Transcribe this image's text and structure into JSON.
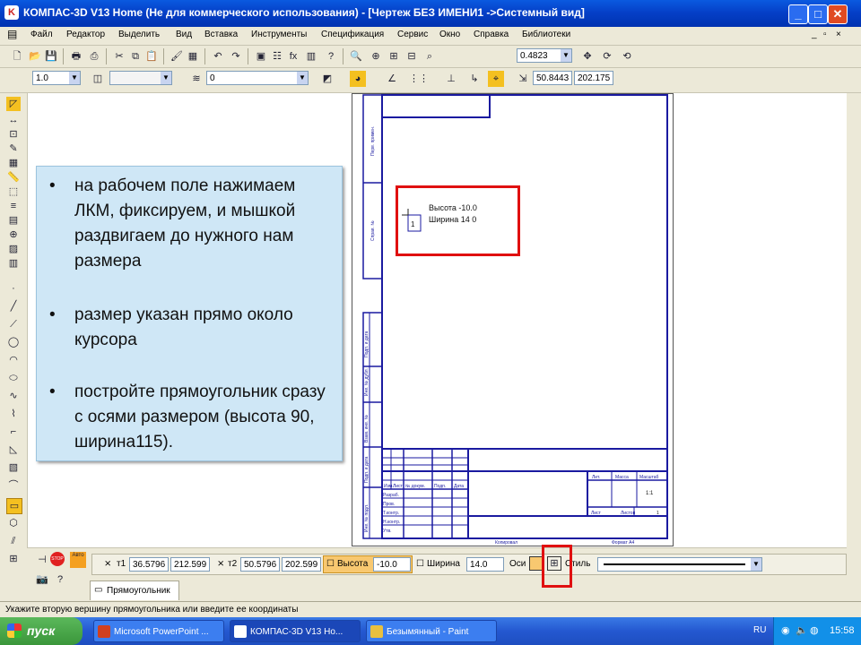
{
  "window": {
    "title": "КОМПАС-3D V13 Home (Не для коммерческого использования) - [Чертеж БЕЗ ИМЕНИ1 ->Системный вид]",
    "minimize": "_",
    "maximize": "□",
    "close": "✕"
  },
  "menu": {
    "items": [
      "Файл",
      "Редактор",
      "Выделить",
      "Вид",
      "Вставка",
      "Инструменты",
      "Спецификация",
      "Сервис",
      "Окно",
      "Справка",
      "Библиотеки"
    ]
  },
  "toolbar1": {
    "zoom_value": "0.4823"
  },
  "toolbar2": {
    "line_scale": "1.0",
    "layer": "0",
    "coord_x": "50.8443",
    "coord_y": "202.175"
  },
  "callout": {
    "bullet": "•",
    "items": [
      "на рабочем поле нажимаем ЛКМ, фиксируем, и мышкой раздвигаем до нужного нам размера",
      "размер указан прямо около курсора",
      "постройте прямоугольник сразу с осями размером (высота 90, ширина115)."
    ]
  },
  "cursor_hint": {
    "height_text": "Высота -10.0",
    "width_text": "Ширина 14 0",
    "marker": "1"
  },
  "drawing": {
    "title_block_bottom_left": "Копировал",
    "title_block_bottom_right": "Формат А4",
    "sheet_label": "Лист",
    "sheets_label": "Листов",
    "lit_label": "Лит.",
    "mass_label": "Масса",
    "scale_label": "Масштаб",
    "scale_value": "1:1",
    "dev_label": "Разраб.",
    "check_label": "Пров.",
    "tcontrol_label": "Т.контр.",
    "ncontrol_label": "Н.контр.",
    "approve_label": "Утв.",
    "change_label": "Изм.",
    "list_label": "Лист",
    "doc_label": "№ докум.",
    "sign_label": "Подп.",
    "date_label": "Дата",
    "sheets_value": "1",
    "side_labels": [
      "Перв. примен.",
      "Справ. №",
      "Подп. и дата",
      "Инв. № дубл.",
      "Взам. инв. №",
      "Подп. и дата",
      "Инв. № подл."
    ]
  },
  "propbar": {
    "t1_label": "т1",
    "t1_x": "36.5796",
    "t1_y": "212.599",
    "t2_label": "т2",
    "t2_x": "50.5796",
    "t2_y": "202.599",
    "height_label": "Высота",
    "height_value": "-10.0",
    "width_label": "Ширина",
    "width_value": "14.0",
    "axes_label": "Оси",
    "style_label": "Стиль",
    "tab_label": "Прямоугольник",
    "stop_label": "STOP",
    "auto_label": "Авто"
  },
  "status": {
    "text": "Укажите вторую вершину прямоугольника или введите ее координаты"
  },
  "taskbar": {
    "start": "пуск",
    "tasks": [
      "Microsoft PowerPoint ...",
      "КОМПАС-3D V13 Ho...",
      "Безымянный - Paint"
    ],
    "lang": "RU",
    "clock": "15:58"
  }
}
